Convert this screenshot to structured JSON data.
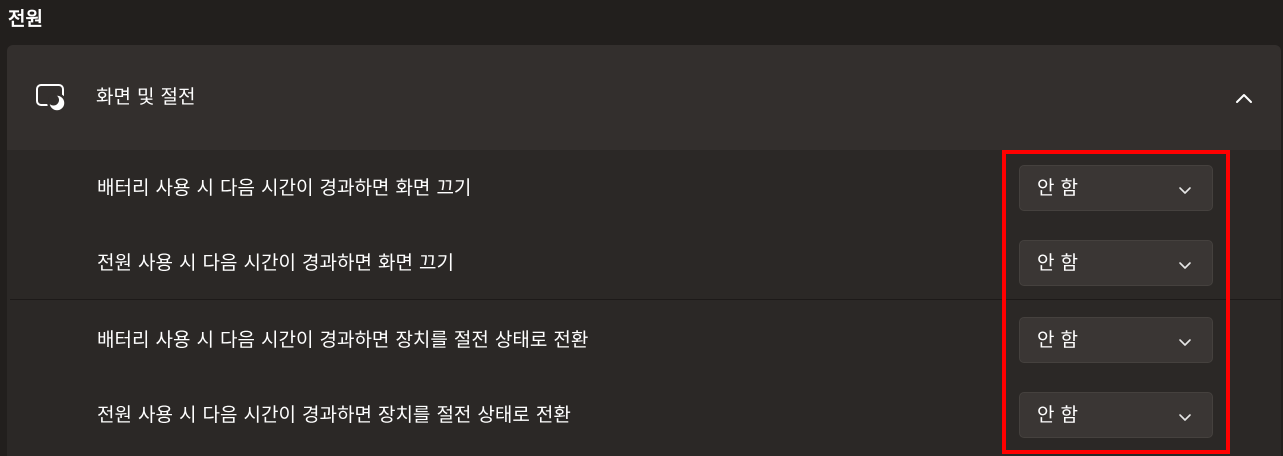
{
  "section": {
    "title": "전원"
  },
  "group": {
    "icon": "screen-sleep-icon",
    "label": "화면 및 절전",
    "expanded_icon": "chevron-up-icon"
  },
  "settings": [
    {
      "label": "배터리 사용 시 다음 시간이 경과하면 화면 끄기",
      "value": "안 함"
    },
    {
      "label": "전원 사용 시 다음 시간이 경과하면 화면 끄기",
      "value": "안 함"
    },
    {
      "label": "배터리 사용 시 다음 시간이 경과하면 장치를 절전 상태로 전환",
      "value": "안 함"
    },
    {
      "label": "전원 사용 시 다음 시간이 경과하면 장치를 절전 상태로 전환",
      "value": "안 함"
    }
  ],
  "colors": {
    "background": "#221f1d",
    "card_header": "#332f2d",
    "card_body": "#2b2826",
    "dropdown": "#3a3634",
    "highlight": "#ff0000"
  }
}
